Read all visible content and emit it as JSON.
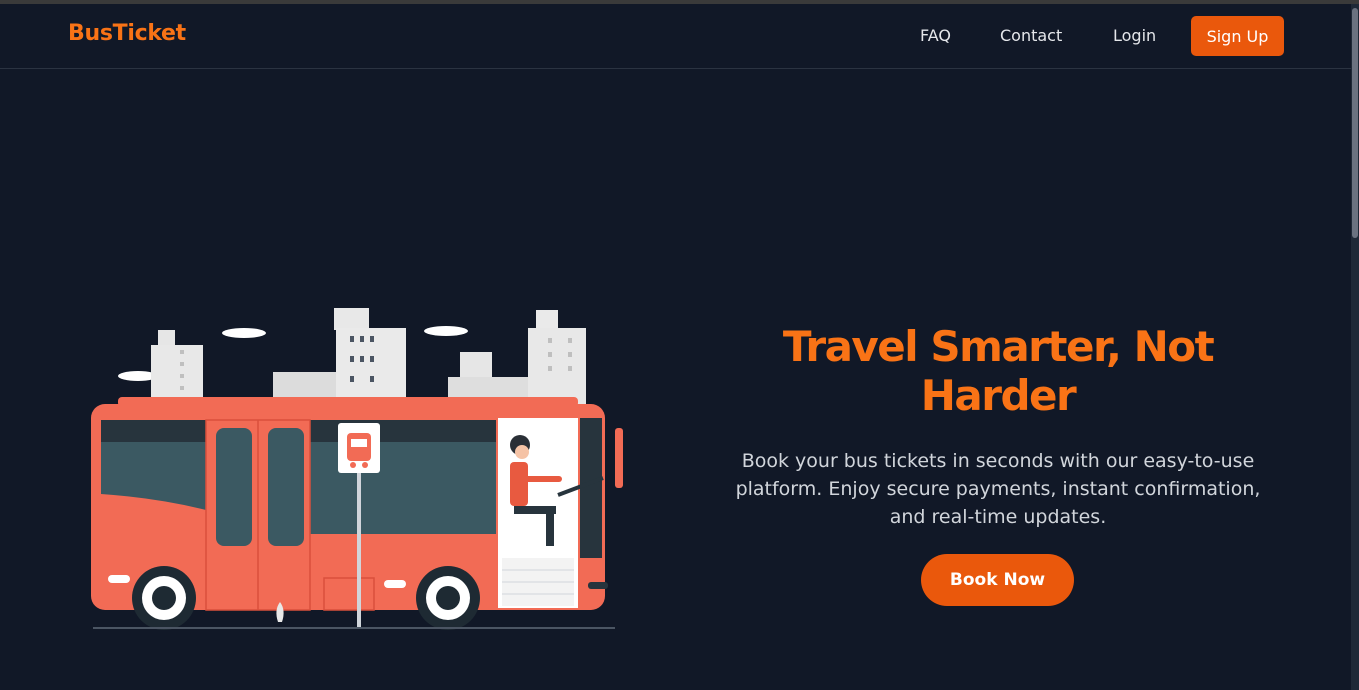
{
  "nav": {
    "logo": "BusTicket",
    "links": [
      "FAQ",
      "Contact",
      "Login"
    ],
    "signup": "Sign Up"
  },
  "hero": {
    "title_line1": "Travel Smarter, Not",
    "title_line2": "Harder",
    "description": "Book your bus tickets in seconds with our easy-to-use platform. Enjoy secure payments, instant confirmation, and real-time updates.",
    "cta": "Book Now"
  },
  "colors": {
    "background": "#111827",
    "accent": "#f97316",
    "button": "#ea580c",
    "bus": "#f26b55"
  },
  "icons": [
    "bus-icon"
  ]
}
